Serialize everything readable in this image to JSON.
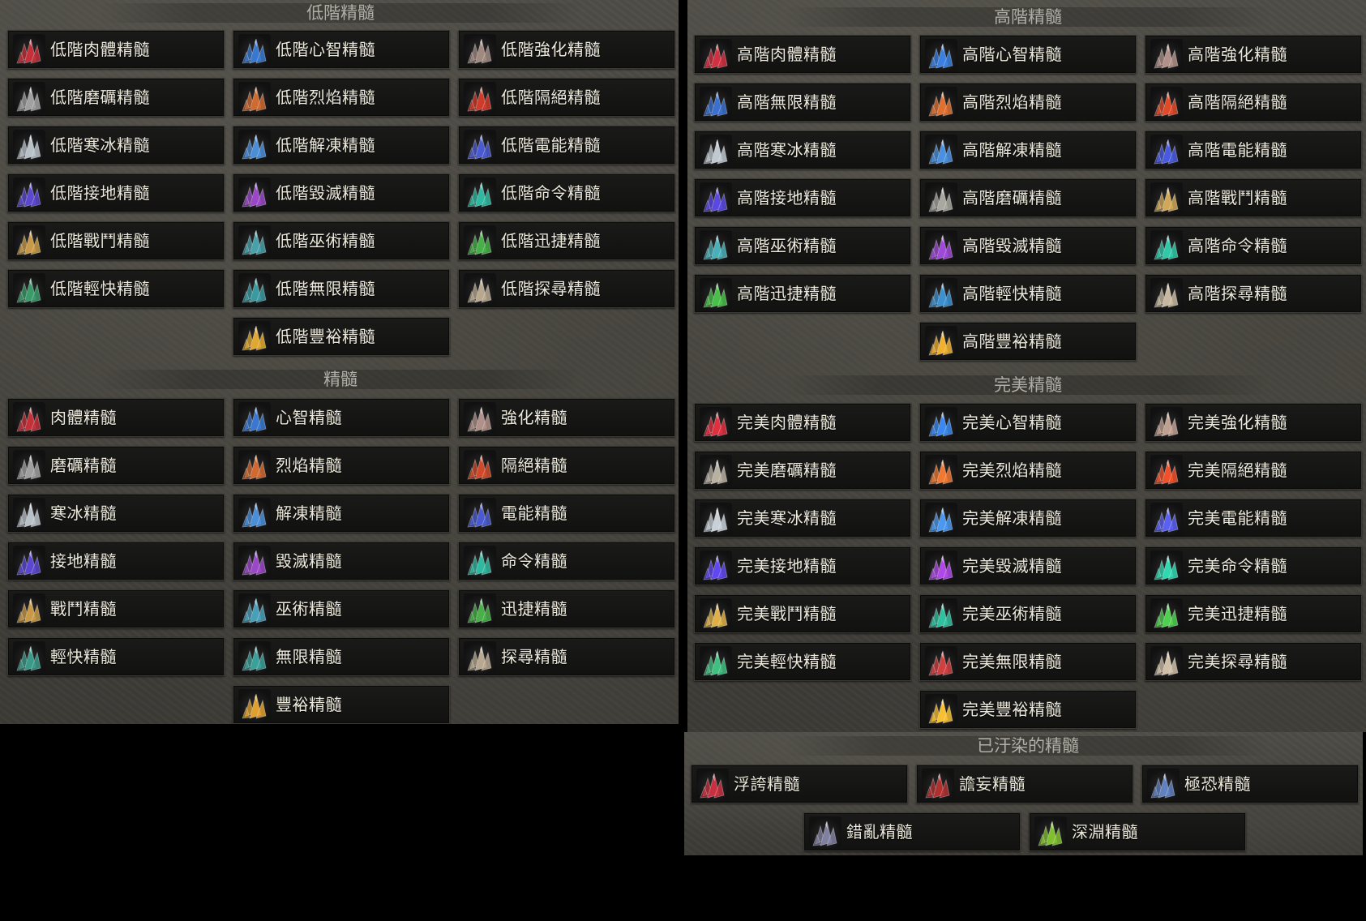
{
  "sections": [
    {
      "id": "lesser",
      "title": "低階精髓",
      "items": [
        {
          "label": "低階肉體精髓",
          "color": "#c2303a"
        },
        {
          "label": "低階心智精髓",
          "color": "#3a78d0"
        },
        {
          "label": "低階強化精髓",
          "color": "#a08a80"
        },
        {
          "label": "低階磨礪精髓",
          "color": "#a0a0a0"
        },
        {
          "label": "低階烈焰精髓",
          "color": "#d06a30"
        },
        {
          "label": "低階隔絕精髓",
          "color": "#d03a2a"
        },
        {
          "label": "低階寒冰精髓",
          "color": "#b8c0c8"
        },
        {
          "label": "低階解凍精髓",
          "color": "#4a8ed8"
        },
        {
          "label": "低階電能精髓",
          "color": "#4a5ad0"
        },
        {
          "label": "低階接地精髓",
          "color": "#5a48d0"
        },
        {
          "label": "低階毀滅精髓",
          "color": "#9a48c8"
        },
        {
          "label": "低階命令精髓",
          "color": "#30b8a0"
        },
        {
          "label": "低階戰鬥精髓",
          "color": "#c89a48"
        },
        {
          "label": "低階巫術精髓",
          "color": "#48a0a8"
        },
        {
          "label": "低階迅捷精髓",
          "color": "#48b048"
        },
        {
          "label": "低階輕快精髓",
          "color": "#3a9a6a"
        },
        {
          "label": "低階無限精髓",
          "color": "#3a9aa0"
        },
        {
          "label": "低階探尋精髓",
          "color": "#b8a890"
        },
        {
          "label": "低階豐裕精髓",
          "color": "#e0a830"
        }
      ]
    },
    {
      "id": "normal",
      "title": "精髓",
      "items": [
        {
          "label": "肉體精髓",
          "color": "#c2303a"
        },
        {
          "label": "心智精髓",
          "color": "#3a78d0"
        },
        {
          "label": "強化精髓",
          "color": "#b09088"
        },
        {
          "label": "磨礪精髓",
          "color": "#a0a0a0"
        },
        {
          "label": "烈焰精髓",
          "color": "#d06a30"
        },
        {
          "label": "隔絕精髓",
          "color": "#d04a2a"
        },
        {
          "label": "寒冰精髓",
          "color": "#b8c0c8"
        },
        {
          "label": "解凍精髓",
          "color": "#4a8ed8"
        },
        {
          "label": "電能精髓",
          "color": "#4a5ad0"
        },
        {
          "label": "接地精髓",
          "color": "#5a48d0"
        },
        {
          "label": "毀滅精髓",
          "color": "#9a48c8"
        },
        {
          "label": "命令精髓",
          "color": "#30b8a0"
        },
        {
          "label": "戰鬥精髓",
          "color": "#c89a48"
        },
        {
          "label": "巫術精髓",
          "color": "#48a0b8"
        },
        {
          "label": "迅捷精髓",
          "color": "#48b048"
        },
        {
          "label": "輕快精髓",
          "color": "#3a9a8a"
        },
        {
          "label": "無限精髓",
          "color": "#3aa09a"
        },
        {
          "label": "探尋精髓",
          "color": "#b8a890"
        },
        {
          "label": "豐裕精髓",
          "color": "#e0a030"
        }
      ]
    },
    {
      "id": "greater",
      "title": "高階精髓",
      "items": [
        {
          "label": "高階肉體精髓",
          "color": "#d03040"
        },
        {
          "label": "高階心智精髓",
          "color": "#3a80e0"
        },
        {
          "label": "高階強化精髓",
          "color": "#b09088"
        },
        {
          "label": "高階無限精髓",
          "color": "#3a70d0"
        },
        {
          "label": "高階烈焰精髓",
          "color": "#e07030"
        },
        {
          "label": "高階隔絕精髓",
          "color": "#e04a2a"
        },
        {
          "label": "高階寒冰精髓",
          "color": "#c0c8d0"
        },
        {
          "label": "高階解凍精髓",
          "color": "#4a90e0"
        },
        {
          "label": "高階電能精髓",
          "color": "#4a5ae0"
        },
        {
          "label": "高階接地精髓",
          "color": "#5a48e0"
        },
        {
          "label": "高階磨礪精髓",
          "color": "#a8a8a0"
        },
        {
          "label": "高階戰鬥精髓",
          "color": "#d0a858"
        },
        {
          "label": "高階巫術精髓",
          "color": "#48b0b8"
        },
        {
          "label": "高階毀滅精髓",
          "color": "#a048d8"
        },
        {
          "label": "高階命令精髓",
          "color": "#30c8a8"
        },
        {
          "label": "高階迅捷精髓",
          "color": "#48c048"
        },
        {
          "label": "高階輕快精髓",
          "color": "#3a90d0"
        },
        {
          "label": "高階探尋精髓",
          "color": "#c8b8a0"
        },
        {
          "label": "高階豐裕精髓",
          "color": "#f0b030"
        }
      ]
    },
    {
      "id": "perfect",
      "title": "完美精髓",
      "items": [
        {
          "label": "完美肉體精髓",
          "color": "#e03040"
        },
        {
          "label": "完美心智精髓",
          "color": "#3a88f0"
        },
        {
          "label": "完美強化精髓",
          "color": "#c0a090"
        },
        {
          "label": "完美磨礪精髓",
          "color": "#b8b0a0"
        },
        {
          "label": "完美烈焰精髓",
          "color": "#f07830"
        },
        {
          "label": "完美隔絕精髓",
          "color": "#f0502a"
        },
        {
          "label": "完美寒冰精髓",
          "color": "#c8d0d8"
        },
        {
          "label": "完美解凍精髓",
          "color": "#4a98f0"
        },
        {
          "label": "完美電能精髓",
          "color": "#5a60f0"
        },
        {
          "label": "完美接地精髓",
          "color": "#6048f0"
        },
        {
          "label": "完美毀滅精髓",
          "color": "#b048e8"
        },
        {
          "label": "完美命令精髓",
          "color": "#30d8b0"
        },
        {
          "label": "完美戰鬥精髓",
          "color": "#e0b048"
        },
        {
          "label": "完美巫術精髓",
          "color": "#30c0a0"
        },
        {
          "label": "完美迅捷精髓",
          "color": "#50d050"
        },
        {
          "label": "完美輕快精髓",
          "color": "#40c080"
        },
        {
          "label": "完美無限精髓",
          "color": "#d04040"
        },
        {
          "label": "完美探尋精髓",
          "color": "#d0c0a8"
        },
        {
          "label": "完美豐裕精髓",
          "color": "#f8c030"
        }
      ]
    },
    {
      "id": "corrupted",
      "title": "已汙染的精髓",
      "items": [
        {
          "label": "浮誇精髓",
          "color": "#c83040"
        },
        {
          "label": "譫妄精髓",
          "color": "#b03030"
        },
        {
          "label": "極恐精髓",
          "color": "#6080c0"
        },
        {
          "label": "錯亂精髓",
          "color": "#8080a0"
        },
        {
          "label": "深淵精髓",
          "color": "#80c030"
        }
      ]
    }
  ]
}
